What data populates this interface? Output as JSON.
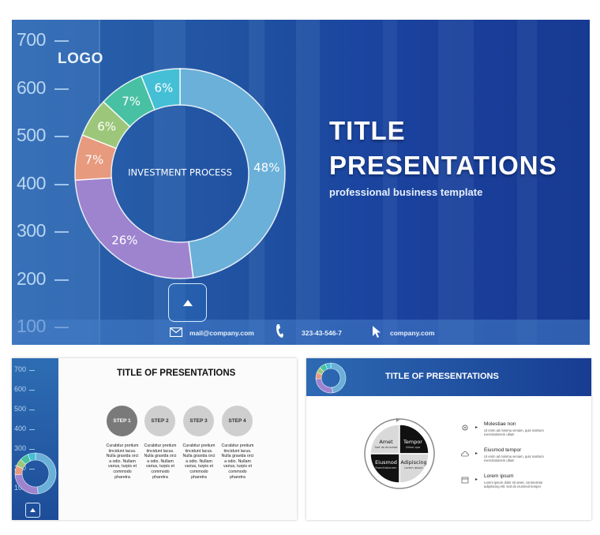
{
  "main_slide": {
    "logo": "LOGO",
    "scale_labels": [
      "700",
      "600",
      "500",
      "400",
      "300",
      "200",
      "100"
    ],
    "donut": {
      "center_label": "INVESTMENT PROCESS",
      "segments": [
        {
          "label": "48%",
          "value": 48,
          "color": "#6ab0d9"
        },
        {
          "label": "26%",
          "value": 26,
          "color": "#9e83cf"
        },
        {
          "label": "7%",
          "value": 7,
          "color": "#e79a7e"
        },
        {
          "label": "6%",
          "value": 6,
          "color": "#9cc77a"
        },
        {
          "label": "7%",
          "value": 7,
          "color": "#48c0a3"
        },
        {
          "label": "6%",
          "value": 6,
          "color": "#44bfd6"
        }
      ]
    },
    "title_line1": "TITLE",
    "title_line2": "PRESENTATIONS",
    "subtitle": "professional business template",
    "footer": {
      "email": "mail@company.com",
      "phone": "323-43-546-7",
      "website": "company.com"
    }
  },
  "thumb_steps": {
    "title": "TITLE OF PRESENTATIONS",
    "scale_labels": [
      "700",
      "600",
      "500",
      "400",
      "300",
      "200",
      "100"
    ],
    "steps": [
      {
        "label": "STEP 1",
        "active": true,
        "desc": "Curabitur pretium tincidunt lacus. Nulla gravida orci a odio. Nullam varius, turpis et commodo pharetra"
      },
      {
        "label": "STEP 2",
        "active": false,
        "desc": "Curabitur pretium tincidunt lacus. Nulla gravida orci a odio. Nullam varius, turpis et commodo pharetra"
      },
      {
        "label": "STEP 3",
        "active": false,
        "desc": "Curabitur pretium tincidunt lacus. Nulla gravida orci a odio. Nullam varius, turpis et commodo pharetra"
      },
      {
        "label": "STEP 4",
        "active": false,
        "desc": "Curabitur pretium tincidunt lacus. Nulla gravida orci a odio. Nullam varius, turpis et commodo pharetra"
      }
    ]
  },
  "thumb_cycle": {
    "title": "TITLE OF PRESENTATIONS",
    "quadrants": [
      {
        "label": "Amet",
        "sub": "Sed do eiusmod"
      },
      {
        "label": "Tempor",
        "sub": "Ullam quo"
      },
      {
        "label": "Adipiscing",
        "sub": "Lorem ipsum"
      },
      {
        "label": "Eiusmod",
        "sub": "Exercitationem"
      }
    ],
    "items": [
      {
        "icon": "gear-icon",
        "title": "Molestiae non",
        "desc": "Ut enim ad minima veniam, quis nostrum exercitationem ullam"
      },
      {
        "icon": "cloud-icon",
        "title": "Eiusmod tempor",
        "desc": "Ut enim ad minima veniam, quis nostrum exercitationem ullam"
      },
      {
        "icon": "calendar-icon",
        "title": "Lorem ipsum",
        "desc": "Lorem ipsum dolor sit amet, consectetur adipisicing elit, sed do eiusmod tempor"
      }
    ]
  }
}
